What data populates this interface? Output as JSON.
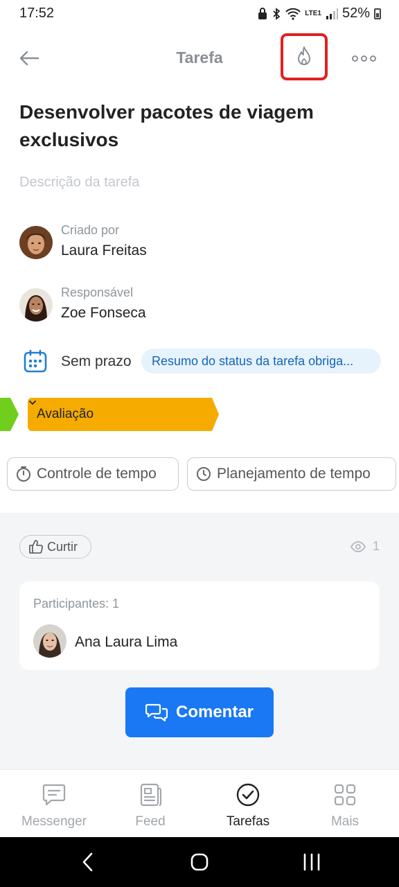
{
  "status_bar": {
    "time": "17:52",
    "battery": "52%",
    "network": "LTE1"
  },
  "header": {
    "title": "Tarefa",
    "back_icon": "arrow-left-icon",
    "flame_icon": "flame-icon",
    "more_icon": "more-dots-icon"
  },
  "task": {
    "title": "Desenvolver pacotes de viagem exclusivos",
    "description_placeholder": "Descrição da tarefa"
  },
  "created_by": {
    "label": "Criado por",
    "name": "Laura Freitas"
  },
  "responsible": {
    "label": "Responsável",
    "name": "Zoe Fonseca"
  },
  "deadline": {
    "text": "Sem prazo",
    "status_pill": "Resumo do status da tarefa obriga..."
  },
  "stage": {
    "label": "Avaliação",
    "color": "#f5ab00",
    "prev_color": "#6fcf1c"
  },
  "time_buttons": {
    "tracking": "Controle de tempo",
    "planning": "Planejamento de tempo"
  },
  "feedback": {
    "like_label": "Curtir",
    "views_count": "1"
  },
  "participants": {
    "label": "Participantes: 1",
    "items": [
      {
        "name": "Ana Laura Lima"
      }
    ]
  },
  "comment_button": {
    "label": "Comentar",
    "color": "#1a78f5"
  },
  "bottom_nav": {
    "items": [
      {
        "label": "Messenger",
        "icon": "chat-bubble-icon",
        "active": false
      },
      {
        "label": "Feed",
        "icon": "feed-icon",
        "active": false
      },
      {
        "label": "Tarefas",
        "icon": "check-circle-icon",
        "active": true
      },
      {
        "label": "Mais",
        "icon": "grid-icon",
        "active": false
      }
    ]
  }
}
